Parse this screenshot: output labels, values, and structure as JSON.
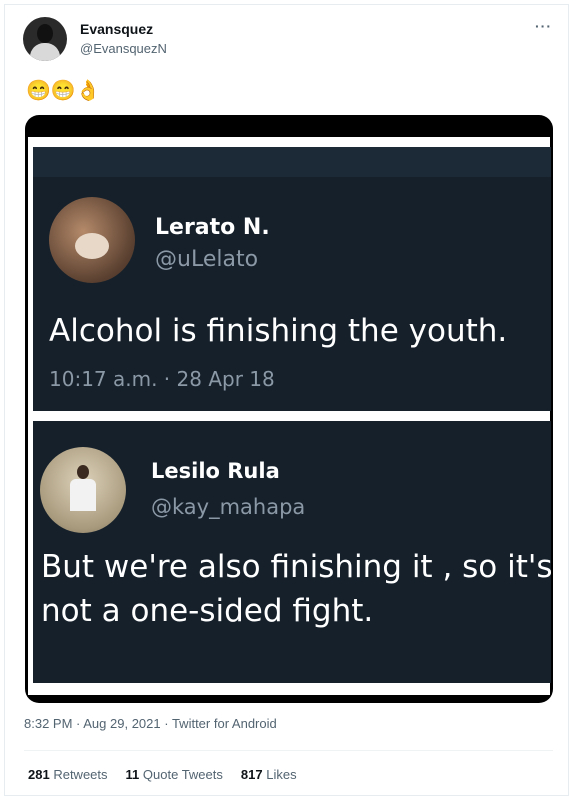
{
  "tweet": {
    "name": "Evansquez",
    "handle": "@EvansquezN",
    "more": "···",
    "emojis": "😁😁👌",
    "time": "8:32 PM",
    "sep1": " · ",
    "date": "Aug 29, 2021",
    "sep2": " · ",
    "client": "Twitter for Android",
    "retweets_count": "281",
    "retweets_label": "Retweets",
    "quotes_count": "11",
    "quotes_label": "Quote Tweets",
    "likes_count": "817",
    "likes_label": "Likes"
  },
  "embedded": [
    {
      "name": "Lerato N.",
      "handle": "@uLelato",
      "text": "Alcohol is finishing the youth.",
      "timestamp": "10:17 a.m. · 28 Apr 18"
    },
    {
      "name": "Lesilo Rula",
      "handle": "@kay_mahapa",
      "text_line1": "But we're also finishing it , so it's",
      "text_line2": "not a one-sided fight."
    }
  ]
}
